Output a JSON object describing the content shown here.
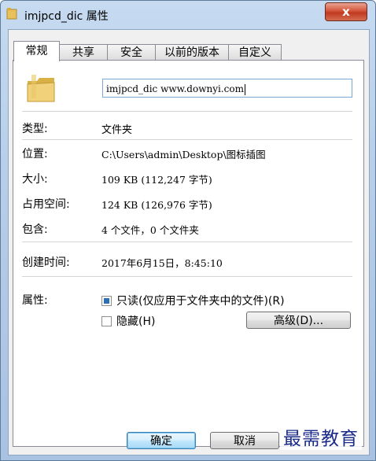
{
  "window": {
    "title": "imjpcd_dic 属性",
    "close_label": "x"
  },
  "tabs": [
    {
      "label": "常规",
      "active": true
    },
    {
      "label": "共享",
      "active": false
    },
    {
      "label": "安全",
      "active": false
    },
    {
      "label": "以前的版本",
      "active": false
    },
    {
      "label": "自定义",
      "active": false
    }
  ],
  "general": {
    "name_value": "imjpcd_dic www.downyi.com",
    "type_label": "类型:",
    "type_value": "文件夹",
    "location_label": "位置:",
    "location_value": "C:\\Users\\admin\\Desktop\\图标插图",
    "size_label": "大小:",
    "size_value": "109 KB (112,247 字节)",
    "size_on_disk_label": "占用空间:",
    "size_on_disk_value": "124 KB (126,976 字节)",
    "contains_label": "包含:",
    "contains_value": "4 个文件，0 个文件夹",
    "created_label": "创建时间:",
    "created_value": "2017年6月15日，8:45:10",
    "attributes_label": "属性:",
    "readonly_label": "只读(仅应用于文件夹中的文件)(R)",
    "readonly_checked": true,
    "hidden_label": "隐藏(H)",
    "hidden_checked": false,
    "advanced_button": "高级(D)..."
  },
  "buttons": {
    "ok": "确定",
    "cancel": "取消"
  },
  "watermark": "最需教育",
  "colors": {
    "accent": "#2b6fb4",
    "close": "#c03a20"
  }
}
